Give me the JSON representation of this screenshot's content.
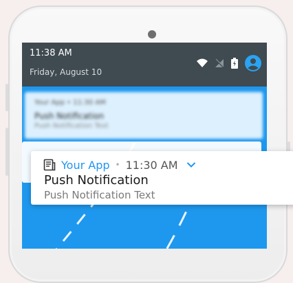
{
  "status_bar": {
    "time": "11:38 AM",
    "date": "Friday, August 10",
    "icons": [
      "wifi-icon",
      "no-signal-icon",
      "battery-icon",
      "account-icon"
    ]
  },
  "blurred_notification": {
    "header": "Your App • 11:30 AM",
    "title": "Push Notification",
    "text": "Push Notification Text"
  },
  "notification": {
    "app_icon": "notification-app-icon",
    "app_name": "Your App",
    "separator": "•",
    "time": "11:30 AM",
    "expand_icon": "chevron-down-icon",
    "title": "Push Notification",
    "text": "Push Notification Text"
  },
  "colors": {
    "screen": "#1e98ee",
    "status_bar": "#3f4a51",
    "accent": "#2196f3"
  }
}
